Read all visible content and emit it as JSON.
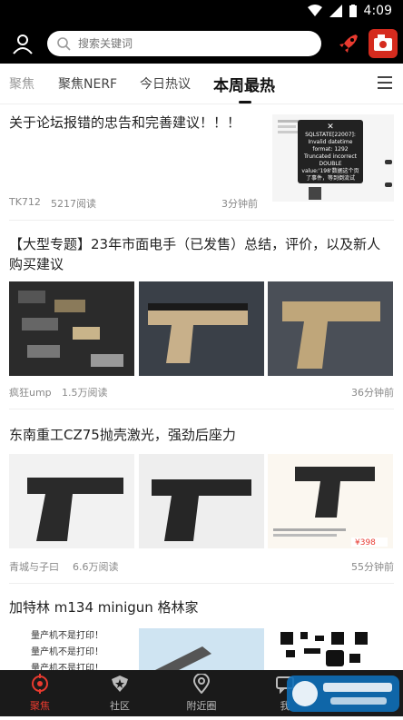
{
  "status": {
    "time": "4:09"
  },
  "search": {
    "placeholder": "搜索关键词"
  },
  "tabs": [
    {
      "label": "聚焦"
    },
    {
      "label": "聚焦NERF"
    },
    {
      "label": "今日热议"
    },
    {
      "label": "本周最热"
    }
  ],
  "posts": [
    {
      "title": "关于论坛报错的忠告和完善建议！！！",
      "author": "TK712",
      "reads": "5217阅读",
      "time": "3分钟前",
      "thumb_text": "SQLSTATE[22007]: Invalid datetime format: 1292 Truncated incorrect DOUBLE value:'198'数据这个页了事件，等到倒流试"
    },
    {
      "title": "【大型专题】23年市面电手（已发售）总结，评价，以及新人购买建议",
      "author": "疯狂ump",
      "reads": "1.5万阅读",
      "time": "36分钟前"
    },
    {
      "title": "东南重工CZ75抛壳激光，强劲后座力",
      "author": "青城与子曰",
      "reads": "6.6万阅读",
      "time": "55分钟前",
      "price": "¥398"
    },
    {
      "title": "加特林 m134 minigun 格林家",
      "img_text": [
        "量产机不是打印！",
        "量产机不是打印！",
        "量产机不是打印！"
      ]
    }
  ],
  "bottom_nav": [
    {
      "label": "聚焦"
    },
    {
      "label": "社区"
    },
    {
      "label": "附近圈"
    },
    {
      "label": "我"
    }
  ],
  "colors": {
    "accent": "#e83a2f",
    "topbar": "#000000",
    "navbar": "#1a1a1a"
  }
}
